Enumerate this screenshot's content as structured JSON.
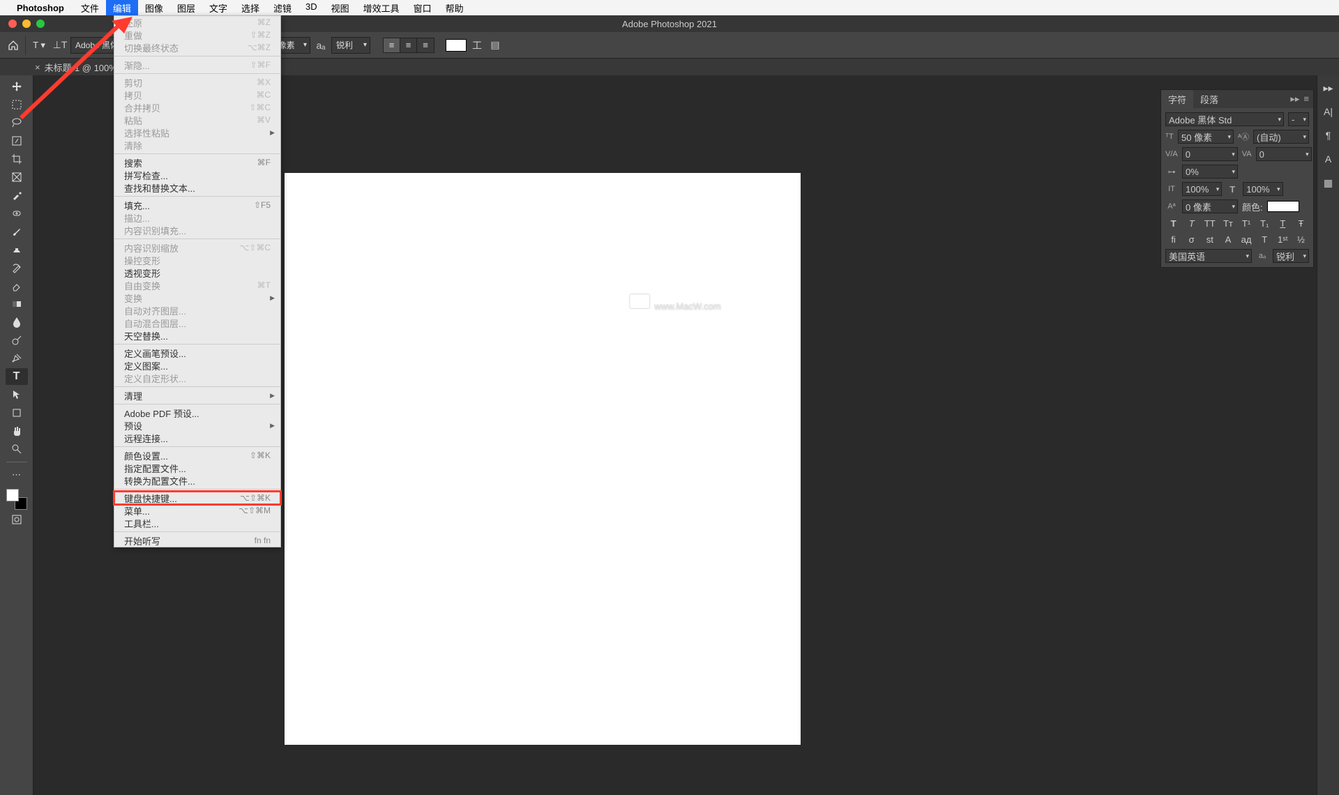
{
  "menubar": {
    "app": "Photoshop",
    "items": [
      "文件",
      "编辑",
      "图像",
      "图层",
      "文字",
      "选择",
      "滤镜",
      "3D",
      "视图",
      "增效工具",
      "窗口",
      "帮助"
    ],
    "active_index": 1
  },
  "window": {
    "title": "Adobe Photoshop 2021"
  },
  "options_bar": {
    "font_family_placeholder": "Adobe 黑体 Std",
    "font_style_placeholder": "-",
    "font_size": "50 像素",
    "aa_label": "aₐ",
    "antialias": "锐利",
    "color": "#ffffff"
  },
  "doc_tab": {
    "label": "未标题-1 @ 100%"
  },
  "edit_menu": [
    {
      "label": "还原",
      "shortcut": "⌘Z",
      "disabled": true
    },
    {
      "label": "重做",
      "shortcut": "⇧⌘Z",
      "disabled": true
    },
    {
      "label": "切换最终状态",
      "shortcut": "⌥⌘Z",
      "disabled": true
    },
    {
      "sep": true
    },
    {
      "label": "渐隐...",
      "shortcut": "⇧⌘F",
      "disabled": true
    },
    {
      "sep": true
    },
    {
      "label": "剪切",
      "shortcut": "⌘X",
      "disabled": true
    },
    {
      "label": "拷贝",
      "shortcut": "⌘C",
      "disabled": true
    },
    {
      "label": "合并拷贝",
      "shortcut": "⇧⌘C",
      "disabled": true
    },
    {
      "label": "粘贴",
      "shortcut": "⌘V",
      "disabled": true
    },
    {
      "label": "选择性粘贴",
      "submenu": true,
      "disabled": true
    },
    {
      "label": "清除",
      "disabled": true
    },
    {
      "sep": true
    },
    {
      "label": "搜索",
      "shortcut": "⌘F"
    },
    {
      "label": "拼写检查..."
    },
    {
      "label": "查找和替换文本..."
    },
    {
      "sep": true
    },
    {
      "label": "填充...",
      "shortcut": "⇧F5"
    },
    {
      "label": "描边...",
      "disabled": true
    },
    {
      "label": "内容识别填充...",
      "disabled": true
    },
    {
      "sep": true
    },
    {
      "label": "内容识别缩放",
      "shortcut": "⌥⇧⌘C",
      "disabled": true
    },
    {
      "label": "操控变形",
      "disabled": true
    },
    {
      "label": "透视变形"
    },
    {
      "label": "自由变换",
      "shortcut": "⌘T",
      "disabled": true
    },
    {
      "label": "变换",
      "submenu": true,
      "disabled": true
    },
    {
      "label": "自动对齐图层...",
      "disabled": true
    },
    {
      "label": "自动混合图层...",
      "disabled": true
    },
    {
      "label": "天空替换..."
    },
    {
      "sep": true
    },
    {
      "label": "定义画笔预设..."
    },
    {
      "label": "定义图案..."
    },
    {
      "label": "定义自定形状...",
      "disabled": true
    },
    {
      "sep": true
    },
    {
      "label": "清理",
      "submenu": true
    },
    {
      "sep": true
    },
    {
      "label": "Adobe PDF 预设..."
    },
    {
      "label": "预设",
      "submenu": true
    },
    {
      "label": "远程连接..."
    },
    {
      "sep": true
    },
    {
      "label": "颜色设置...",
      "shortcut": "⇧⌘K"
    },
    {
      "label": "指定配置文件..."
    },
    {
      "label": "转换为配置文件..."
    },
    {
      "sep": true
    },
    {
      "label": "键盘快捷键...",
      "shortcut": "⌥⇧⌘K",
      "highlight": true
    },
    {
      "label": "菜单...",
      "shortcut": "⌥⇧⌘M"
    },
    {
      "label": "工具栏..."
    },
    {
      "sep": true
    },
    {
      "label": "开始听写",
      "shortcut": "fn fn"
    }
  ],
  "char_panel": {
    "tabs": [
      "字符",
      "段落"
    ],
    "font_family": "Adobe 黑体 Std",
    "font_style": "-",
    "size": "50 像素",
    "leading": "(自动)",
    "va": "0",
    "tracking": "0",
    "vscale": "0%",
    "hscale": "100%",
    "baseline": "100%",
    "color_label": "颜色:",
    "baseline_shift": "0 像素",
    "language": "美国英语",
    "aa": "锐利"
  },
  "watermark": "www.MacW.com"
}
